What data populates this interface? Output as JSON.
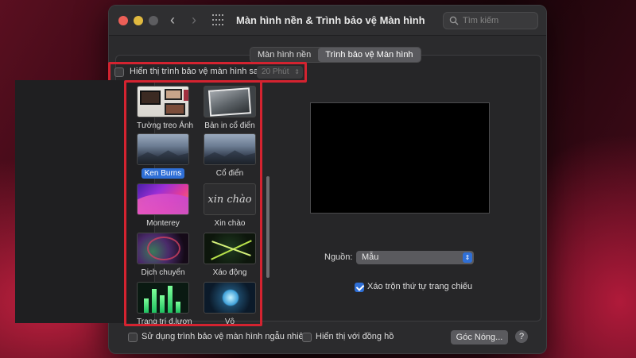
{
  "window": {
    "title": "Màn hình nền & Trình bảo vệ Màn hình"
  },
  "search": {
    "placeholder": "Tìm kiếm"
  },
  "tabs": [
    {
      "label": "Màn hình nền",
      "active": false
    },
    {
      "label": "Trình bảo vệ Màn hình",
      "active": true
    }
  ],
  "screensaver_toggle": {
    "label": "Hiển thị trình bảo vệ màn hình sau",
    "checked": false,
    "time_value": "20 Phút"
  },
  "savers": [
    {
      "label": "Tường treo Ảnh",
      "icon": "wall-photos-thumbnail",
      "selected": false
    },
    {
      "label": "Bản in cổ điển",
      "icon": "classic-print-thumbnail",
      "selected": false
    },
    {
      "label": "Ken Burns",
      "icon": "ken-burns-thumbnail",
      "selected": true
    },
    {
      "label": "Cổ điển",
      "icon": "classic-thumbnail",
      "selected": false
    },
    {
      "label": "Monterey",
      "icon": "monterey-thumbnail",
      "selected": false
    },
    {
      "label": "Xin chào",
      "icon": "hello-thumbnail",
      "selected": false
    },
    {
      "label": "Dịch chuyển",
      "icon": "drift-thumbnail",
      "selected": false
    },
    {
      "label": "Xáo động",
      "icon": "shake-thumbnail",
      "selected": false
    },
    {
      "label": "Trang trí đ.lượn",
      "icon": "arabesque-thumbnail",
      "selected": false
    },
    {
      "label": "Vô",
      "icon": "vortex-thumbnail",
      "selected": false
    }
  ],
  "hello_text": "xin chào",
  "source": {
    "label": "Nguồn:",
    "value": "Mẫu"
  },
  "shuffle": {
    "label": "Xáo trộn thứ tự trang chiếu",
    "checked": true
  },
  "bottom": {
    "random_label": "Sử dụng trình bảo vệ màn hình ngẫu nhiên",
    "random_checked": false,
    "clock_label": "Hiển thị với đồng hồ",
    "clock_checked": false,
    "hot_corners_label": "Góc Nóng...",
    "help_label": "?"
  },
  "colors": {
    "accent": "#2f6fd6",
    "highlight_box": "#d42330",
    "window_bg": "#2b2b2d"
  }
}
